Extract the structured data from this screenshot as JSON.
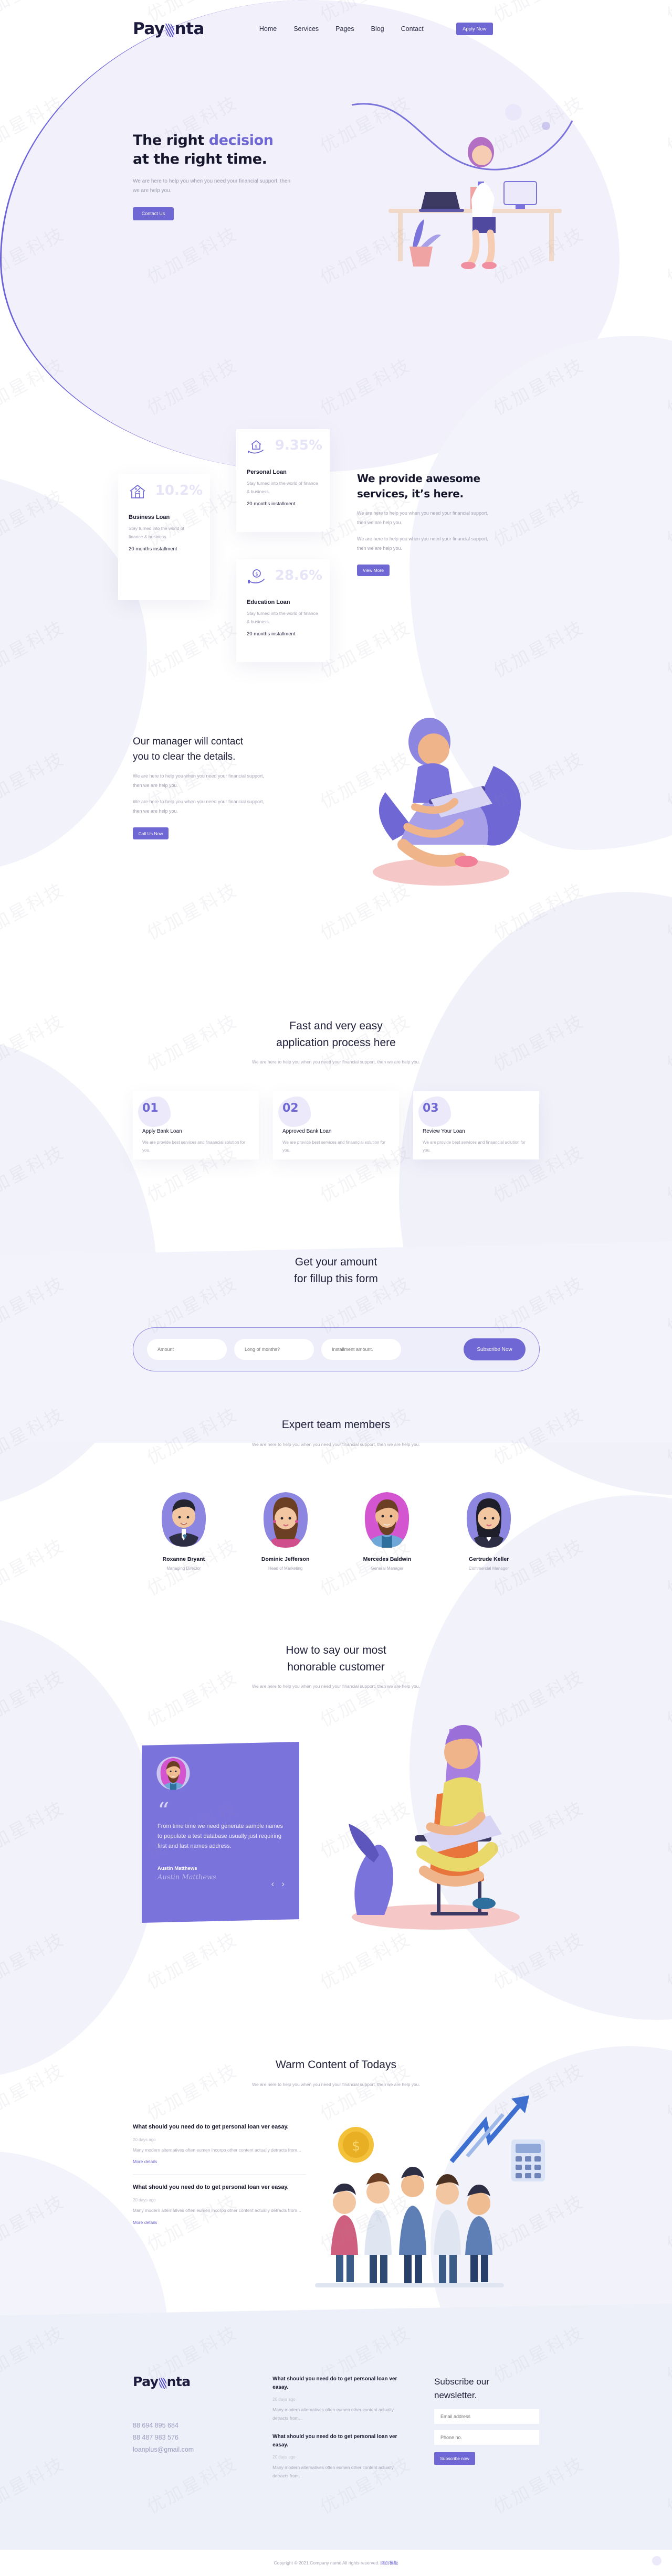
{
  "brand": {
    "name": "Payonta"
  },
  "nav": {
    "items": [
      {
        "label": "Home"
      },
      {
        "label": "Services"
      },
      {
        "label": "Pages"
      },
      {
        "label": "Blog"
      },
      {
        "label": "Contact"
      }
    ],
    "cta": "Apply Now"
  },
  "hero": {
    "title_1": "The right ",
    "title_accent": "decision",
    "title_2": "at the right time.",
    "body": "We are here to help you when you need your financial support, then we are help you.",
    "cta": "Contact Us"
  },
  "loans": {
    "cards": [
      {
        "rate": "10.2%",
        "title": "Business Loan",
        "desc": "Stay turned into the world of finance & business.",
        "installment": "20 months installment",
        "icon": "house-percent-icon"
      },
      {
        "rate": "9.35%",
        "title": "Personal Loan",
        "desc": "Stay turned into the world of finance & business.",
        "installment": "20 months installment",
        "icon": "hand-house-dollar-icon"
      },
      {
        "rate": "28.6%",
        "title": "Education Loan",
        "desc": "Stay turned into the world of finance & business.",
        "installment": "20 months installment",
        "icon": "hand-coin-icon"
      }
    ]
  },
  "services": {
    "title_1": "We provide awesome",
    "title_2": "services, it’s here.",
    "body_1": "We are here to help you when you need your financial support, then we are help you.",
    "body_2": "We are here to help you when you need your financial support, then we are help you.",
    "cta": "View More"
  },
  "manager": {
    "title_1": "Our manager will contact",
    "title_2": "you to clear the details.",
    "body_1": "We are here to help you when you need your financial support, then we are help you.",
    "body_2": "We are here to help you when you need your financial support, then we are help you.",
    "cta": "Call Us Now"
  },
  "process": {
    "title_1": "Fast and very easy",
    "title_2": "application process here",
    "subtitle": "We are here to help you when you need your financial support, then we are help you.",
    "steps": [
      {
        "num": "01",
        "title": "Apply Bank Loan",
        "desc": "We are provide best services and finaancial solution for you."
      },
      {
        "num": "02",
        "title": "Approved Bank Loan",
        "desc": "We are provide best services and finaancial solution for you."
      },
      {
        "num": "03",
        "title": "Review Your Loan",
        "desc": "We are provide best services and finaancial solution for you."
      }
    ]
  },
  "amount_form": {
    "title_1": "Get your amount",
    "title_2": "for fillup this form",
    "amount_placeholder": "Amount",
    "months_placeholder": "Long of months?",
    "installment_placeholder": "Installment amount.",
    "cta": "Subscribe Now"
  },
  "team": {
    "title": "Expert team members",
    "subtitle": "We are here to help you when you need your financial support, then we are help you.",
    "members": [
      {
        "name": "Roxanne Bryant",
        "role": "Managing Director"
      },
      {
        "name": "Dominic Jefferson",
        "role": "Head of Marketing"
      },
      {
        "name": "Mercedes Baldwin",
        "role": "General Manager"
      },
      {
        "name": "Gertrude Keller",
        "role": "Commercial Manager"
      }
    ]
  },
  "testimonial": {
    "title_1": "How to say our most",
    "title_2": "honorable customer",
    "subtitle": "We are here to help you when you need your financial support, then we are help you.",
    "quote": "From time time we need generate sample names to populate a test database usually just requiring first and last names address.",
    "author": "Austin Matthews",
    "signature": "Austin Matthews",
    "prev": "‹",
    "next": "›"
  },
  "blog": {
    "title": "Warm Content of Todays",
    "subtitle": "We are here to help you when you need your financial support, then we are help you.",
    "posts": [
      {
        "title": "What should you need do to get personal loan ver easay.",
        "date": "20 days ago",
        "excerpt": "Many modern alternatives often eumen incorpo other content actually detracts from…",
        "more": "More details"
      },
      {
        "title": "What should you need do to get personal loan ver easay.",
        "date": "20 days ago",
        "excerpt": "Many modern alternatives often eumen incorpo other content actually detracts from…",
        "more": "More details"
      }
    ]
  },
  "footer": {
    "phone_1": "88 694 895 684",
    "phone_2": "88 487 983 576",
    "email": "loanplus@gmail.com",
    "posts": [
      {
        "title": "What should you need do to get personal loan ver easay.",
        "date": "20 days ago",
        "excerpt": "Many modern alternatives often eumen other content actually detracts from…"
      },
      {
        "title": "What should you need do to get personal loan ver easay.",
        "date": "20 days ago",
        "excerpt": "Many modern alternatives often eumen other content actually detracts from…"
      }
    ],
    "newsletter": {
      "title_1": "Subscribe our",
      "title_2": "newsletter.",
      "email_placeholder": "Email address",
      "phone_placeholder": "Phone no.",
      "cta": "Subscribe now"
    },
    "copyright": "Copyright © 2021.Company name All rights reserved.",
    "copyright_cn": "网页模板"
  },
  "colors": {
    "accent": "#6f67d4",
    "accent_light": "#eceafa",
    "ink": "#15152b",
    "muted": "#a8a8ba",
    "band": "#f3f3fb",
    "footer_bg": "#eef0f9"
  },
  "watermark": {
    "text": "优加星科技"
  }
}
